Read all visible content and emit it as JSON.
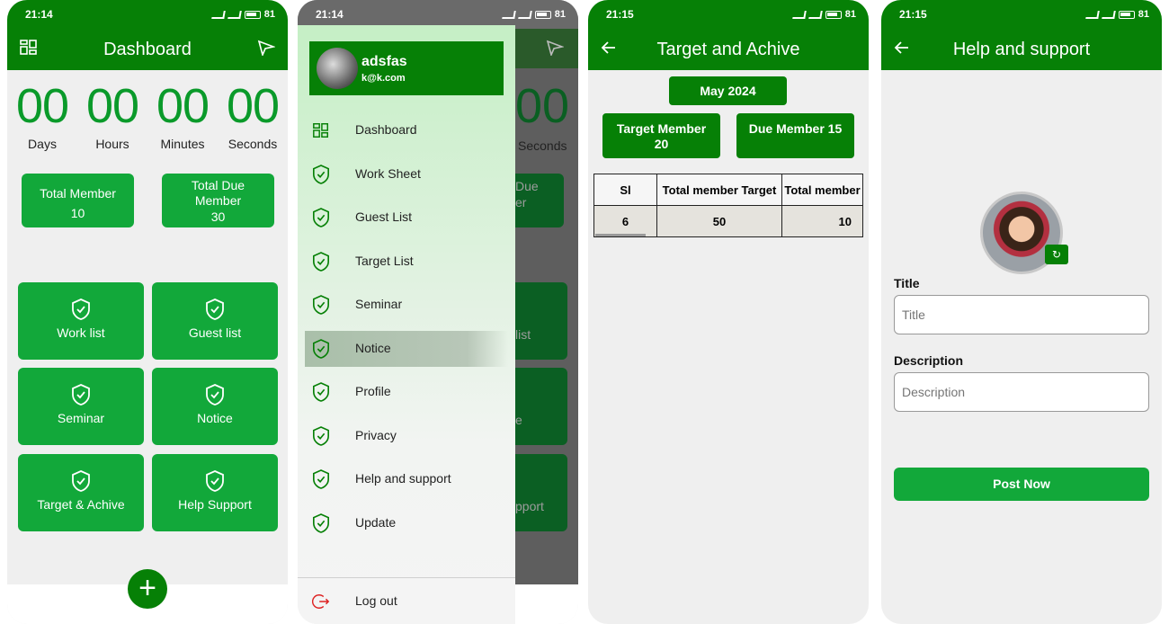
{
  "status": {
    "time1": "21:14",
    "time2": "21:14",
    "time3": "21:15",
    "time4": "21:15",
    "battery": "81"
  },
  "dashboard": {
    "title": "Dashboard",
    "counters": [
      {
        "value": "00",
        "label": "Days"
      },
      {
        "value": "00",
        "label": "Hours"
      },
      {
        "value": "00",
        "label": "Minutes"
      },
      {
        "value": "00",
        "label": "Seconds"
      }
    ],
    "total_member_label": "Total Member",
    "total_member_value": "10",
    "total_due_label": "Total Due Member",
    "total_due_value": "30",
    "tiles": [
      "Work list",
      "Guest list",
      "Seminar",
      "Notice",
      "Target & Achive",
      "Help Support"
    ],
    "fab": "+"
  },
  "drawer": {
    "user_name": "adsfas",
    "user_email": "k@k.com",
    "items": [
      "Dashboard",
      "Work Sheet",
      "Guest List",
      "Target List",
      "Seminar",
      "Notice",
      "Profile",
      "Privacy",
      "Help and support",
      "Update"
    ],
    "logout": "Log out",
    "bg_counter": "00",
    "bg_seconds": "Seconds",
    "bg_due_1": "Due",
    "bg_due_2": "er",
    "bg_tile_1": "list",
    "bg_tile_2": "e",
    "bg_tile_3": "pport"
  },
  "target": {
    "title": "Target and Achive",
    "month": "May 2024",
    "target_member": "Target Member 20",
    "due_member": "Due Member 15",
    "table": {
      "headers": [
        "Sl",
        "Total member Target",
        "Total member"
      ],
      "rows": [
        [
          "6",
          "50",
          "10"
        ]
      ]
    }
  },
  "help": {
    "title": "Help and support",
    "title_label": "Title",
    "title_placeholder": "Title",
    "desc_label": "Description",
    "desc_placeholder": "Description",
    "post_button": "Post Now"
  }
}
